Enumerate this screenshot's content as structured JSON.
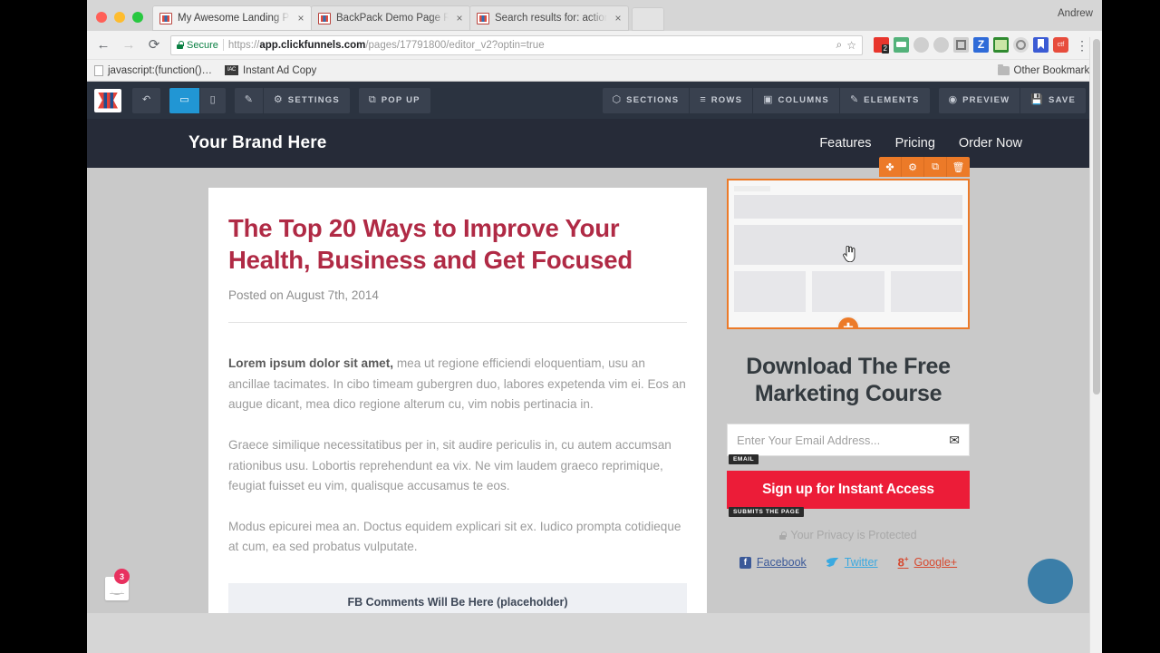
{
  "browser": {
    "profile_name": "Andrew",
    "tabs": [
      {
        "title": "My Awesome Landing Page - |",
        "active": true,
        "close_label": "×"
      },
      {
        "title": "BackPack Demo Page Resourc",
        "active": false,
        "close_label": "×"
      },
      {
        "title": "Search results for: actionetics",
        "active": false,
        "close_label": "×"
      }
    ],
    "nav": {
      "back": "←",
      "forward": "→",
      "reload": "⟳"
    },
    "omnibox": {
      "security_label": "Secure",
      "scheme": "https://",
      "host": "app.clickfunnels.com",
      "path": "/pages/17791800/editor_v2?optin=true",
      "zoom_icon": "⌕",
      "star_icon": "☆"
    },
    "menu_icon": "⋮",
    "bookmarks": [
      {
        "label": "javascript:(function()…",
        "icon": "page-icon"
      },
      {
        "label": "Instant Ad Copy",
        "icon": "iac-icon"
      }
    ],
    "other_bookmarks_label": "Other Bookmarks"
  },
  "editor_toolbar": {
    "logo_name": "clickfunnels-logo",
    "undo_icon": "↶",
    "desktop_icon": "▭",
    "mobile_icon": "▯",
    "brush_icon": "✎",
    "settings_label": "SETTINGS",
    "settings_icon": "⚙",
    "popup_label": "POP UP",
    "popup_icon": "⧉",
    "sections_label": "SECTIONS",
    "sections_icon": "⬡",
    "rows_label": "ROWS",
    "rows_icon": "≡",
    "columns_label": "COLUMNS",
    "columns_icon": "▣",
    "elements_label": "ELEMENTS",
    "elements_icon": "✎",
    "preview_label": "PREVIEW",
    "preview_icon": "◉",
    "save_label": "SAVE",
    "save_icon": "Ὃe"
  },
  "site": {
    "brand": "Your Brand Here",
    "nav": [
      {
        "label": "Features"
      },
      {
        "label": "Pricing"
      },
      {
        "label": "Order Now"
      }
    ]
  },
  "article": {
    "title": "The Top 20 Ways to Improve Your Health, Business and Get Focused",
    "date": "Posted on August 7th, 2014",
    "lead_bold": "Lorem ipsum dolor sit amet,",
    "lead_rest": " mea ut regione efficiendi eloquentiam, usu an ancillae tacimates. In cibo timeam gubergren duo, labores expetenda vim ei. Eos an augue dicant, mea dico regione alterum cu, vim nobis pertinacia in.",
    "p2": "Graece similique necessitatibus per in, sit audire periculis in, cu autem accumsan rationibus usu. Lobortis reprehendunt ea vix. Ne vim laudem graeco reprimique, feugiat fuisset eu vim, qualisque accusamus te eos.",
    "p3": "Modus epicurei mea an. Doctus equidem explicari sit ex. Iudico prompta cotidieque at cum, ea sed probatus vulputate.",
    "fb_placeholder": "FB Comments Will Be Here (placeholder)"
  },
  "optin": {
    "selection_toolbar": [
      {
        "name": "move-handle",
        "icon": "✤"
      },
      {
        "name": "settings-gear",
        "icon": "⚙"
      },
      {
        "name": "duplicate",
        "icon": "⧉"
      },
      {
        "name": "delete",
        "icon": "Ὕ1"
      }
    ],
    "add_element_icon": "✚",
    "headline": "Download The Free Marketing Course",
    "email_placeholder": "Enter Your Email Address...",
    "email_icon": "✉",
    "email_tag": "EMAIL",
    "cta_label": "Sign up for Instant Access",
    "cta_tag": "SUBMITS THE PAGE",
    "privacy_text": "Your Privacy is Protected",
    "socials": [
      {
        "label": "Facebook",
        "icon": "facebook-icon"
      },
      {
        "label": "Twitter",
        "icon": "twitter-icon"
      },
      {
        "label": "Google+",
        "icon": "googleplus-icon"
      }
    ]
  },
  "widgets": {
    "chat_badge_count": "3",
    "orb_name": "blue-circle-overlay"
  },
  "colors": {
    "accent_orange": "#ec7a28",
    "cta_red": "#ec1c38",
    "toolbar_dark": "#2b3340",
    "active_blue": "#2196d4",
    "title_maroon": "#b02a45"
  }
}
